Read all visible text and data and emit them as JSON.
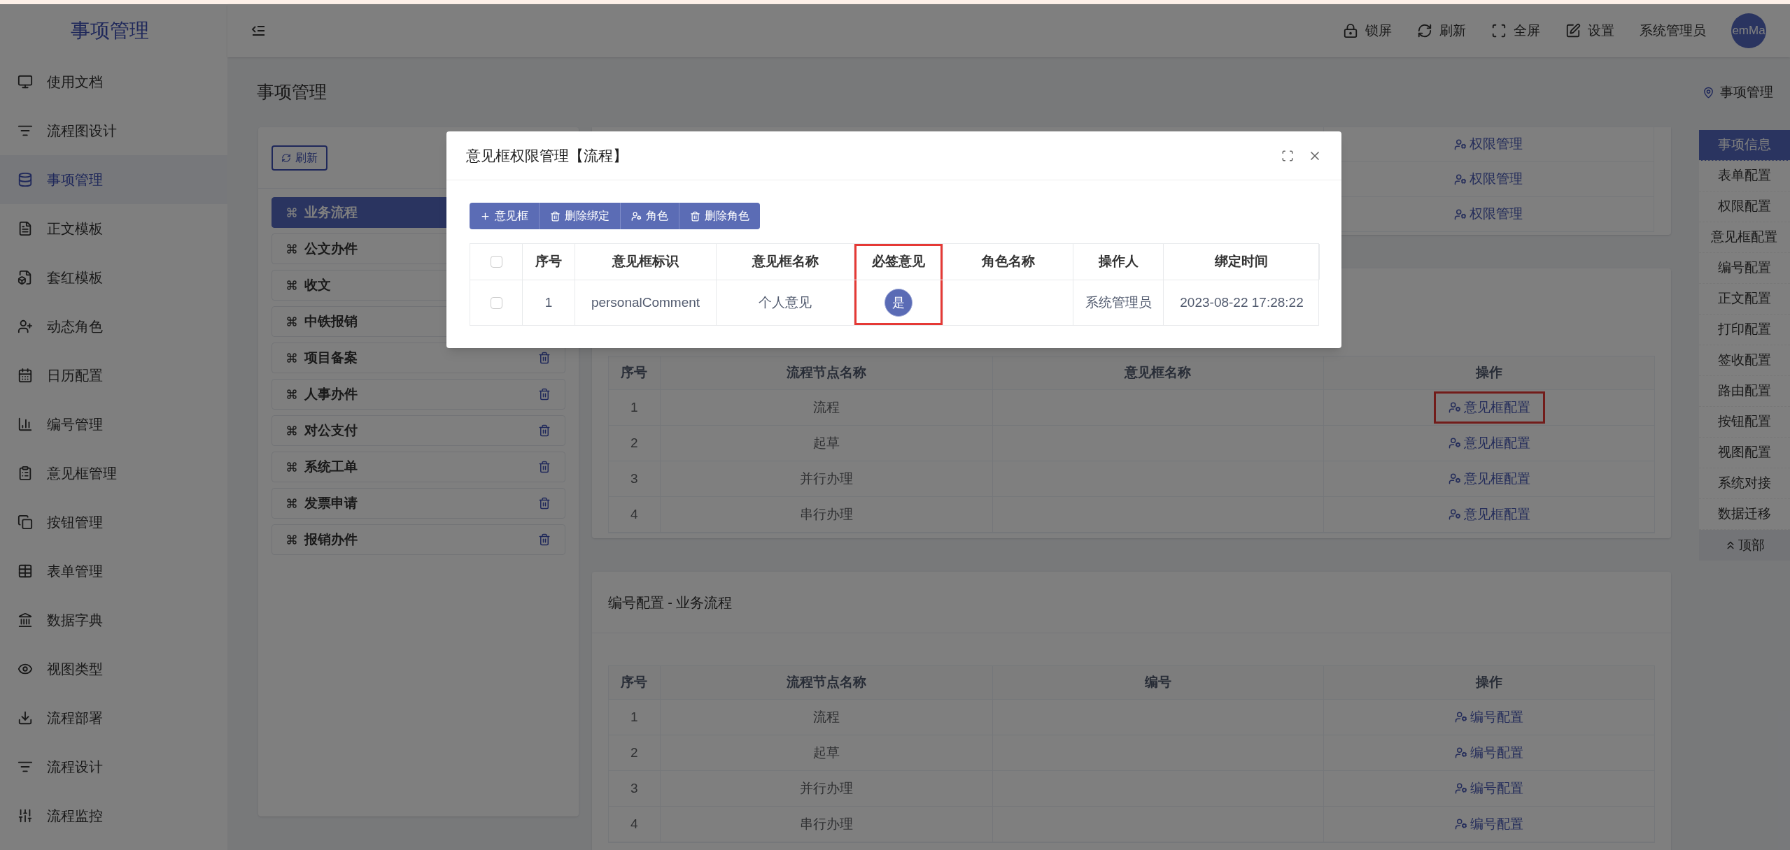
{
  "app": {
    "logo": "事项管理"
  },
  "header": {
    "actions": [
      {
        "label": "锁屏"
      },
      {
        "label": "刷新"
      },
      {
        "label": "全屏"
      },
      {
        "label": "设置"
      }
    ],
    "user": "系统管理员",
    "avatar": "emMa"
  },
  "sidebar": {
    "items": [
      {
        "label": "使用文档",
        "selected": false
      },
      {
        "label": "流程图设计",
        "selected": false
      },
      {
        "label": "事项管理",
        "selected": true
      },
      {
        "label": "正文模板",
        "selected": false
      },
      {
        "label": "套红模板",
        "selected": false
      },
      {
        "label": "动态角色",
        "selected": false
      },
      {
        "label": "日历配置",
        "selected": false
      },
      {
        "label": "编号管理",
        "selected": false
      },
      {
        "label": "意见框管理",
        "selected": false
      },
      {
        "label": "按钮管理",
        "selected": false
      },
      {
        "label": "表单管理",
        "selected": false
      },
      {
        "label": "数据字典",
        "selected": false
      },
      {
        "label": "视图类型",
        "selected": false
      },
      {
        "label": "流程部署",
        "selected": false
      },
      {
        "label": "流程设计",
        "selected": false
      },
      {
        "label": "流程监控",
        "selected": false
      }
    ]
  },
  "page": {
    "title": "事项管理",
    "breadcrumb": "事项管理"
  },
  "flow_list": {
    "refresh_button": "刷新",
    "items": [
      {
        "label": "业务流程",
        "selected": true
      },
      {
        "label": "公文办件",
        "selected": false
      },
      {
        "label": "收文",
        "selected": false
      },
      {
        "label": "中铁报销",
        "selected": false
      },
      {
        "label": "项目备案",
        "selected": false,
        "trash": true
      },
      {
        "label": "人事办件",
        "selected": false,
        "trash": true
      },
      {
        "label": "对公支付",
        "selected": false,
        "trash": true
      },
      {
        "label": "系统工单",
        "selected": false,
        "trash": true
      },
      {
        "label": "发票申请",
        "selected": false,
        "trash": true
      },
      {
        "label": "报销办件",
        "selected": false,
        "trash": true
      }
    ]
  },
  "permission_card": {
    "rows": [
      {
        "action": "权限管理"
      },
      {
        "action": "权限管理"
      },
      {
        "action": "权限管理"
      }
    ]
  },
  "comment_card": {
    "columns": [
      "序号",
      "流程节点名称",
      "意见框名称",
      "操作"
    ],
    "rows": [
      {
        "index": "1",
        "node": "流程",
        "action": "意见框配置",
        "highlighted": true
      },
      {
        "index": "2",
        "node": "起草",
        "action": "意见框配置",
        "highlighted": false
      },
      {
        "index": "3",
        "node": "并行办理",
        "action": "意见框配置",
        "highlighted": false
      },
      {
        "index": "4",
        "node": "串行办理",
        "action": "意见框配置",
        "highlighted": false
      }
    ]
  },
  "number_card": {
    "title": "编号配置 - 业务流程",
    "columns": [
      "序号",
      "流程节点名称",
      "编号",
      "操作"
    ],
    "rows": [
      {
        "index": "1",
        "node": "流程",
        "action": "编号配置"
      },
      {
        "index": "2",
        "node": "起草",
        "action": "编号配置"
      },
      {
        "index": "3",
        "node": "并行办理",
        "action": "编号配置"
      },
      {
        "index": "4",
        "node": "串行办理",
        "action": "编号配置"
      }
    ]
  },
  "right_nav": {
    "items": [
      {
        "label": "事项信息",
        "selected": true
      },
      {
        "label": "表单配置",
        "selected": false
      },
      {
        "label": "权限配置",
        "selected": false
      },
      {
        "label": "意见框配置",
        "selected": false
      },
      {
        "label": "编号配置",
        "selected": false
      },
      {
        "label": "正文配置",
        "selected": false
      },
      {
        "label": "打印配置",
        "selected": false
      },
      {
        "label": "签收配置",
        "selected": false
      },
      {
        "label": "路由配置",
        "selected": false
      },
      {
        "label": "按钮配置",
        "selected": false
      },
      {
        "label": "视图配置",
        "selected": false
      },
      {
        "label": "系统对接",
        "selected": false
      },
      {
        "label": "数据迁移",
        "selected": false
      }
    ],
    "top_button": "顶部"
  },
  "dialog": {
    "title": "意见框权限管理【流程】",
    "toolbar": [
      {
        "kind": "add",
        "label": "意见框"
      },
      {
        "kind": "delete",
        "label": "删除绑定"
      },
      {
        "kind": "user",
        "label": "角色"
      },
      {
        "kind": "delete",
        "label": "删除角色"
      }
    ],
    "select_all_checked": false,
    "columns": [
      {
        "label": "序号",
        "highlighted": false
      },
      {
        "label": "意见框标识",
        "highlighted": false
      },
      {
        "label": "意见框名称",
        "highlighted": false
      },
      {
        "label": "必签意见",
        "highlighted": true
      },
      {
        "label": "角色名称",
        "highlighted": false
      },
      {
        "label": "操作人",
        "highlighted": false
      },
      {
        "label": "绑定时间",
        "highlighted": false
      }
    ],
    "rows": [
      {
        "checked": false,
        "index": "1",
        "key": "personalComment",
        "name": "个人意见",
        "required": "是",
        "operator": "系统管理员",
        "time": "2023-08-22 17:28:22"
      }
    ]
  }
}
